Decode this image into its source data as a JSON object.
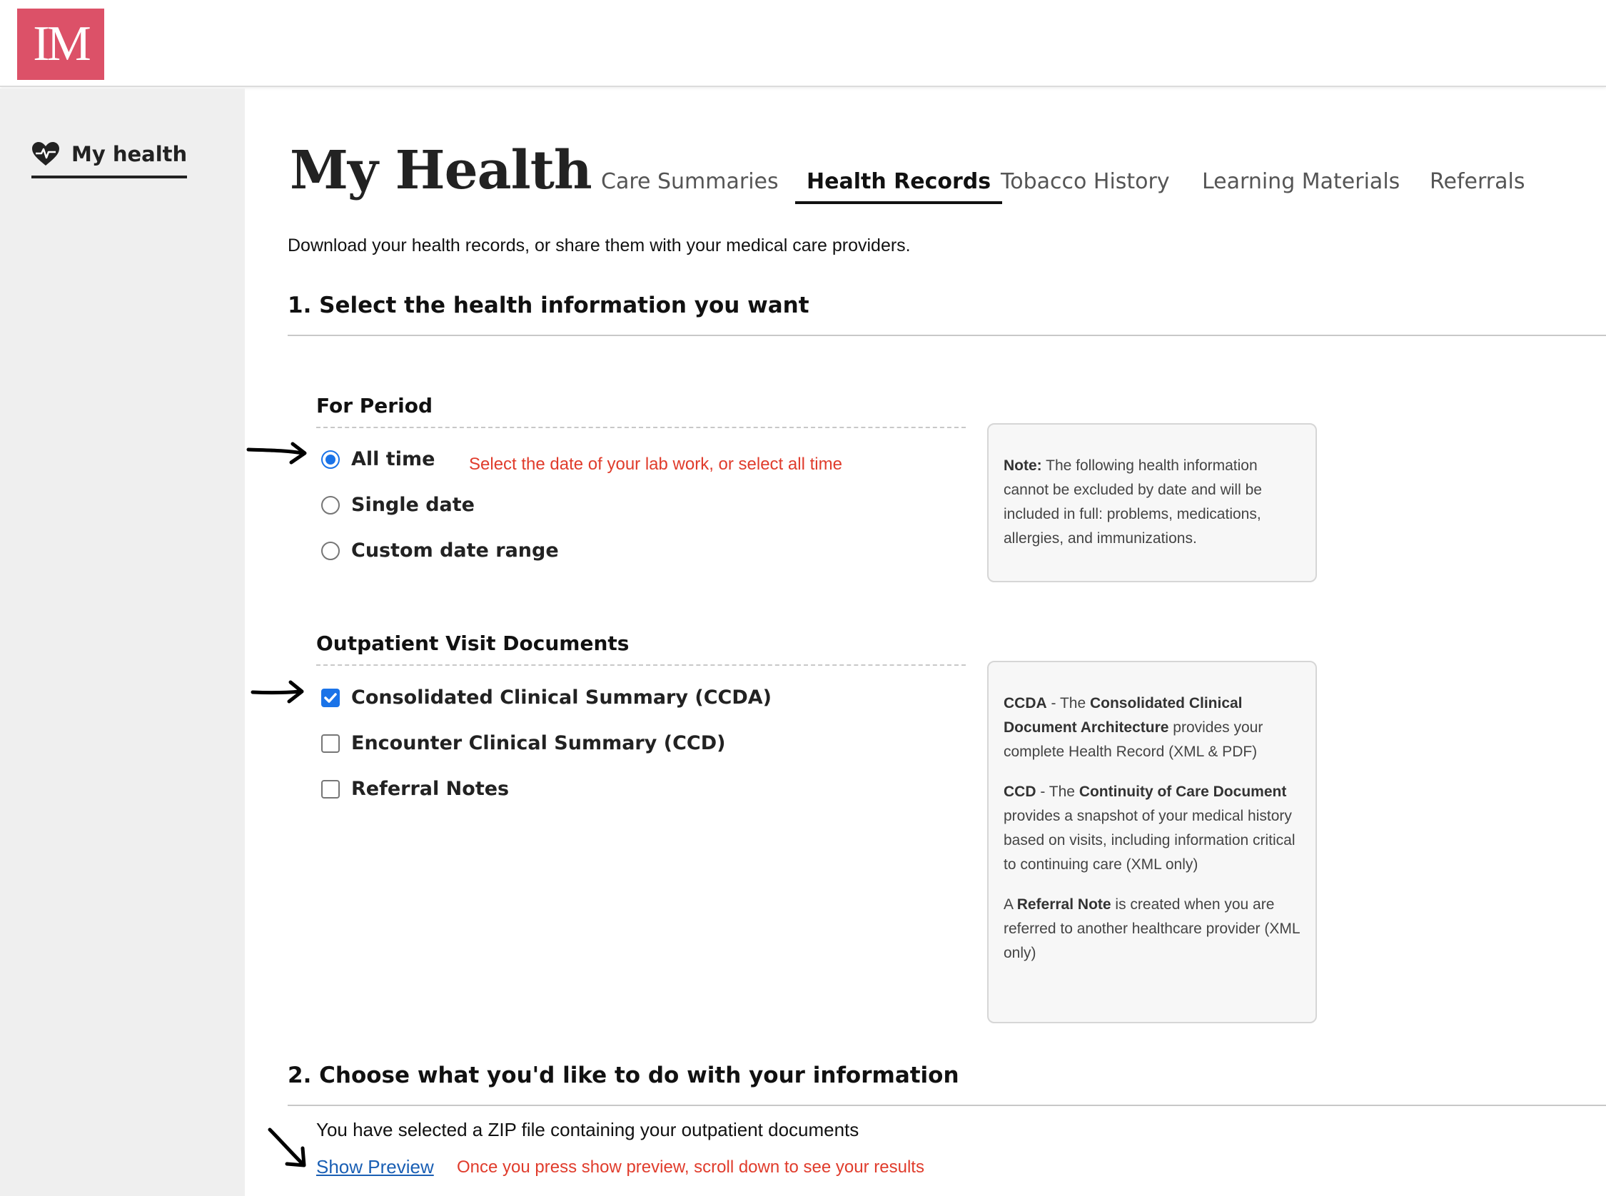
{
  "app": {
    "logo_text": "IM"
  },
  "sidebar": {
    "items": [
      {
        "label": "My health",
        "icon": "heart-pulse-icon"
      }
    ]
  },
  "page": {
    "title": "My Health",
    "tabs": [
      {
        "label": "Care Summaries",
        "active": false
      },
      {
        "label": "Health Records",
        "active": true
      },
      {
        "label": "Tobacco History",
        "active": false
      },
      {
        "label": "Learning Materials",
        "active": false
      },
      {
        "label": "Referrals",
        "active": false
      }
    ],
    "subtitle": "Download your health records, or share them with your medical care providers."
  },
  "section1": {
    "heading": "1. Select the health information you want",
    "period": {
      "heading": "For Period",
      "options": [
        {
          "label": "All time",
          "selected": true
        },
        {
          "label": "Single date",
          "selected": false
        },
        {
          "label": "Custom date range",
          "selected": false
        }
      ],
      "hint": "Select the date of your lab work, or select all time"
    },
    "period_note": {
      "label": "Note:",
      "text": "The following health information cannot be excluded by date and will be included in full: problems, medications, allergies, and immunizations."
    },
    "documents": {
      "heading": "Outpatient Visit Documents",
      "options": [
        {
          "label": "Consolidated Clinical Summary (CCDA)",
          "checked": true
        },
        {
          "label": "Encounter Clinical Summary (CCD)",
          "checked": false
        },
        {
          "label": "Referral Notes",
          "checked": false
        }
      ]
    },
    "docs_note": {
      "ccda_abbr": "CCDA",
      "ccda_dash": " - The ",
      "ccda_name": "Consolidated Clinical Document Architecture",
      "ccda_text": " provides your complete Health Record (XML & PDF)",
      "ccd_abbr": "CCD",
      "ccd_dash": " - The ",
      "ccd_name": "Continuity of Care Document",
      "ccd_text": " provides a snapshot of your medical history based on visits, including information critical to continuing care (XML only)",
      "ref_pre": "A ",
      "ref_name": "Referral Note",
      "ref_text": " is created when you are referred to another healthcare provider (XML only)"
    }
  },
  "section2": {
    "heading": "2. Choose what you'd like to do with your information",
    "zip_text": "You have selected a ZIP file containing your outpatient documents",
    "preview_link": "Show Preview",
    "hint": "Once you press show preview, scroll down to see your results"
  },
  "colors": {
    "logo_bg": "#dc5168",
    "accent": "#1a73e8",
    "hint": "#e03c2c",
    "link": "#1a5fb4"
  }
}
